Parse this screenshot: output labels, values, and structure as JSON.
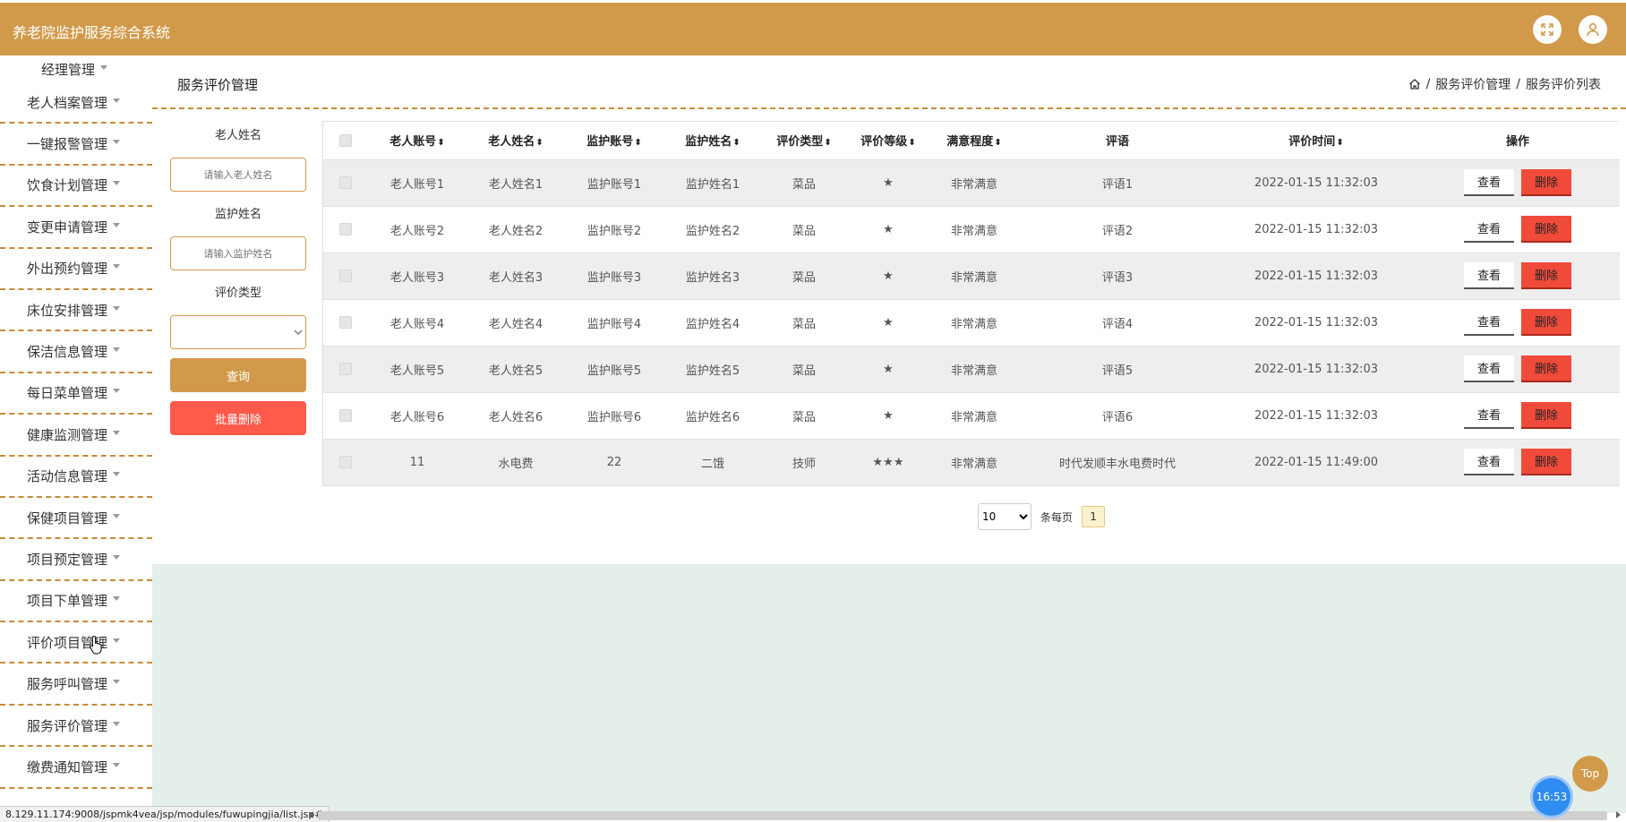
{
  "app": {
    "title": "养老院监护服务综合系统"
  },
  "header": {
    "fullscreen_icon": "fullscreen-icon",
    "user_icon": "user-icon"
  },
  "sidebar": {
    "items": [
      {
        "label": "经理管理"
      },
      {
        "label": "老人档案管理"
      },
      {
        "label": "一键报警管理"
      },
      {
        "label": "饮食计划管理"
      },
      {
        "label": "变更申请管理"
      },
      {
        "label": "外出预约管理"
      },
      {
        "label": "床位安排管理"
      },
      {
        "label": "保洁信息管理"
      },
      {
        "label": "每日菜单管理"
      },
      {
        "label": "健康监测管理"
      },
      {
        "label": "活动信息管理"
      },
      {
        "label": "保健项目管理"
      },
      {
        "label": "项目预定管理"
      },
      {
        "label": "项目下单管理"
      },
      {
        "label": "评价项目管理"
      },
      {
        "label": "服务呼叫管理"
      },
      {
        "label": "服务评价管理"
      },
      {
        "label": "缴费通知管理"
      }
    ]
  },
  "page": {
    "title": "服务评价管理",
    "breadcrumb": [
      "服务评价管理",
      "服务评价列表"
    ],
    "separator": "/"
  },
  "search": {
    "elder_name_label": "老人姓名",
    "elder_name_placeholder": "请输入老人姓名",
    "guardian_name_label": "监护姓名",
    "guardian_name_placeholder": "请输入监护姓名",
    "eval_type_label": "评价类型",
    "query_button": "查询",
    "batch_delete_button": "批量删除",
    "query_color": "#d19a4a",
    "delete_color": "#ff5a4a"
  },
  "table": {
    "headers": {
      "elder_account": "老人账号",
      "elder_name": "老人姓名",
      "guardian_account": "监护账号",
      "guardian_name": "监护姓名",
      "eval_type": "评价类型",
      "eval_level": "评价等级",
      "satisfaction": "满意程度",
      "comment": "评语",
      "eval_time": "评价时间",
      "actions": "操作"
    },
    "sort_glyph": "⬍",
    "view_label": "查看",
    "delete_label": "删除",
    "rows": [
      {
        "elder_account": "老人账号1",
        "elder_name": "老人姓名1",
        "guardian_account": "监护账号1",
        "guardian_name": "监护姓名1",
        "eval_type": "菜品",
        "eval_level": "★",
        "satisfaction": "非常满意",
        "comment": "评语1",
        "eval_time": "2022-01-15 11:32:03"
      },
      {
        "elder_account": "老人账号2",
        "elder_name": "老人姓名2",
        "guardian_account": "监护账号2",
        "guardian_name": "监护姓名2",
        "eval_type": "菜品",
        "eval_level": "★",
        "satisfaction": "非常满意",
        "comment": "评语2",
        "eval_time": "2022-01-15 11:32:03"
      },
      {
        "elder_account": "老人账号3",
        "elder_name": "老人姓名3",
        "guardian_account": "监护账号3",
        "guardian_name": "监护姓名3",
        "eval_type": "菜品",
        "eval_level": "★",
        "satisfaction": "非常满意",
        "comment": "评语3",
        "eval_time": "2022-01-15 11:32:03"
      },
      {
        "elder_account": "老人账号4",
        "elder_name": "老人姓名4",
        "guardian_account": "监护账号4",
        "guardian_name": "监护姓名4",
        "eval_type": "菜品",
        "eval_level": "★",
        "satisfaction": "非常满意",
        "comment": "评语4",
        "eval_time": "2022-01-15 11:32:03"
      },
      {
        "elder_account": "老人账号5",
        "elder_name": "老人姓名5",
        "guardian_account": "监护账号5",
        "guardian_name": "监护姓名5",
        "eval_type": "菜品",
        "eval_level": "★",
        "satisfaction": "非常满意",
        "comment": "评语5",
        "eval_time": "2022-01-15 11:32:03"
      },
      {
        "elder_account": "老人账号6",
        "elder_name": "老人姓名6",
        "guardian_account": "监护账号6",
        "guardian_name": "监护姓名6",
        "eval_type": "菜品",
        "eval_level": "★",
        "satisfaction": "非常满意",
        "comment": "评语6",
        "eval_time": "2022-01-15 11:32:03"
      },
      {
        "elder_account": "11",
        "elder_name": "水电费",
        "guardian_account": "22",
        "guardian_name": "二饿",
        "eval_type": "技师",
        "eval_level": "★★★",
        "satisfaction": "非常满意",
        "comment": "时代发顺丰水电费时代",
        "eval_time": "2022-01-15 11:49:00"
      }
    ]
  },
  "pager": {
    "page_size": "10",
    "per_page_label": "条每页",
    "current_page": "1"
  },
  "status": {
    "url": "8.129.11.174:9008/jspmk4vea/jsp/modules/fuwupingjia/list.jsp#"
  },
  "widgets": {
    "top_label": "Top",
    "clock_time": "16:53"
  },
  "colors": {
    "brand": "#d19a4a",
    "danger": "#f04a3a",
    "content_bg": "#e5efea"
  }
}
